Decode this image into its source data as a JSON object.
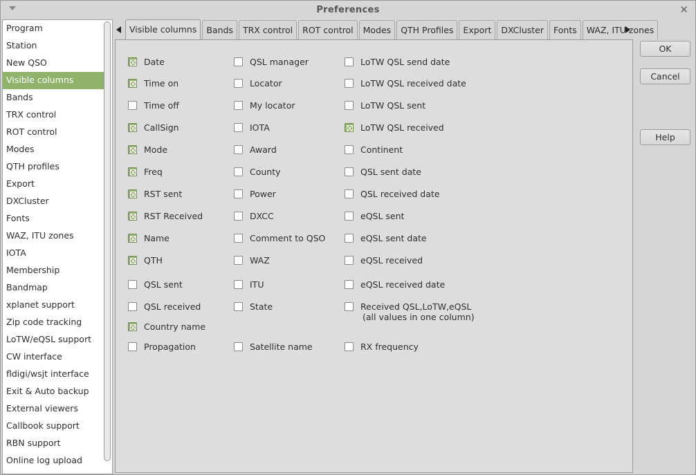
{
  "window": {
    "title": "Preferences"
  },
  "sidebar": {
    "items": [
      {
        "label": "Program"
      },
      {
        "label": "Station"
      },
      {
        "label": "New QSO"
      },
      {
        "label": "Visible columns",
        "selected": true
      },
      {
        "label": "Bands"
      },
      {
        "label": "TRX control"
      },
      {
        "label": "ROT control"
      },
      {
        "label": "Modes"
      },
      {
        "label": "QTH profiles"
      },
      {
        "label": "Export"
      },
      {
        "label": "DXCluster"
      },
      {
        "label": "Fonts"
      },
      {
        "label": "WAZ, ITU zones"
      },
      {
        "label": "IOTA"
      },
      {
        "label": "Membership"
      },
      {
        "label": "Bandmap"
      },
      {
        "label": "xplanet support"
      },
      {
        "label": "Zip code tracking"
      },
      {
        "label": "LoTW/eQSL support"
      },
      {
        "label": "CW interface"
      },
      {
        "label": "fldigi/wsjt interface"
      },
      {
        "label": "Exit & Auto backup"
      },
      {
        "label": "External viewers"
      },
      {
        "label": "Callbook support"
      },
      {
        "label": "RBN support"
      },
      {
        "label": "Online log upload"
      }
    ]
  },
  "tabs": [
    {
      "label": "Visible columns",
      "active": true
    },
    {
      "label": "Bands"
    },
    {
      "label": "TRX control"
    },
    {
      "label": "ROT control"
    },
    {
      "label": "Modes"
    },
    {
      "label": "QTH Profiles"
    },
    {
      "label": "Export"
    },
    {
      "label": "DXCluster"
    },
    {
      "label": "Fonts"
    },
    {
      "label": "WAZ, ITU zones"
    }
  ],
  "columns": {
    "col1": [
      {
        "label": "Date",
        "checked": true
      },
      {
        "label": "Time on",
        "checked": true
      },
      {
        "label": "Time off",
        "checked": false
      },
      {
        "label": "CallSign",
        "checked": true
      },
      {
        "label": "Mode",
        "checked": true
      },
      {
        "label": "Freq",
        "checked": true
      },
      {
        "label": "RST sent",
        "checked": true
      },
      {
        "label": "RST Received",
        "checked": true
      },
      {
        "label": "Name",
        "checked": true
      },
      {
        "label": "QTH",
        "checked": true
      },
      {
        "label": "QSL sent",
        "checked": false
      },
      {
        "label": "QSL received",
        "checked": false
      },
      {
        "label": "Country name",
        "checked": true
      },
      {
        "label": "Propagation",
        "checked": false
      }
    ],
    "col2": [
      {
        "label": "QSL manager",
        "checked": false
      },
      {
        "label": "Locator",
        "checked": false
      },
      {
        "label": "My locator",
        "checked": false
      },
      {
        "label": "IOTA",
        "checked": false
      },
      {
        "label": "Award",
        "checked": false
      },
      {
        "label": "County",
        "checked": false
      },
      {
        "label": "Power",
        "checked": false
      },
      {
        "label": "DXCC",
        "checked": false
      },
      {
        "label": "Comment to QSO",
        "checked": false
      },
      {
        "label": "WAZ",
        "checked": false
      },
      {
        "label": "ITU",
        "checked": false
      },
      {
        "label": "State",
        "checked": false
      },
      {
        "label": "Satellite name",
        "checked": false
      }
    ],
    "col3": [
      {
        "label": "LoTW QSL send date",
        "checked": false
      },
      {
        "label": "LoTW QSL received date",
        "checked": false
      },
      {
        "label": "LoTW QSL sent",
        "checked": false
      },
      {
        "label": "LoTW QSL received",
        "checked": true
      },
      {
        "label": "Continent",
        "checked": false
      },
      {
        "label": "QSL sent date",
        "checked": false
      },
      {
        "label": "QSL received date",
        "checked": false
      },
      {
        "label": "eQSL sent",
        "checked": false
      },
      {
        "label": "eQSL sent date",
        "checked": false
      },
      {
        "label": "eQSL received",
        "checked": false
      },
      {
        "label": "eQSL received date",
        "checked": false
      },
      {
        "label": "Received QSL,LoTW,eQSL",
        "checked": false
      },
      {
        "label": "RX frequency",
        "checked": false
      }
    ],
    "note": "(all values in one column)"
  },
  "buttons": {
    "ok": "OK",
    "cancel": "Cancel",
    "help": "Help"
  },
  "colors": {
    "accent": "#8fb36a"
  }
}
